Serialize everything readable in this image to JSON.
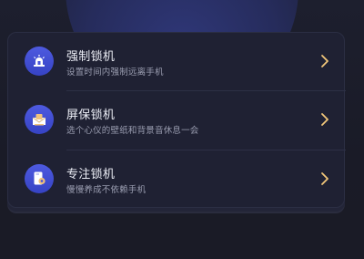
{
  "colors": {
    "accent": "#3f4bd0",
    "chevron": "#f2c77a",
    "background": "#1b1c28",
    "card": "#1f2133"
  },
  "options": [
    {
      "title": "强制锁机",
      "subtitle": "设置时间内强制远离手机",
      "icon": "siren-icon"
    },
    {
      "title": "屏保锁机",
      "subtitle": "选个心仪的壁纸和背景音休息一会",
      "icon": "screensaver-icon"
    },
    {
      "title": "专注锁机",
      "subtitle": "慢慢养成不依赖手机",
      "icon": "focus-phone-icon"
    }
  ]
}
